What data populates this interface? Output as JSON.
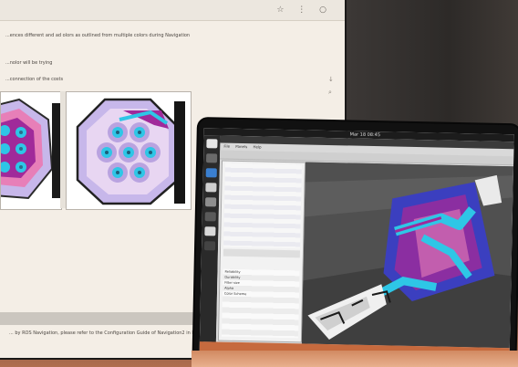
{
  "monitor": {
    "doc_line_1": "...ences different and ad olors as outlined from multiple colors during Navigation",
    "doc_line_2": "...nolor will be trying",
    "doc_line_3": "...connection of the costs",
    "footer": "... by ROS Navigation, please refer to the Configuration Guide of Navigation2 in ROS Navigation Tutorial"
  },
  "laptop": {
    "clock": "Mar 18 08:45",
    "menu": "File Panels Help",
    "props": [
      "Reliability",
      "Durability",
      "Filter size",
      "Alpha",
      "Color Scheme"
    ]
  },
  "colors": {
    "map_cyan": "#2ec6e6",
    "map_magenta": "#a02a9a",
    "map_pink": "#e77fb8",
    "map_blue": "#3b3fbf",
    "map_lavender": "#c7b7ea",
    "statusbar_orange": "#c66a3e"
  }
}
